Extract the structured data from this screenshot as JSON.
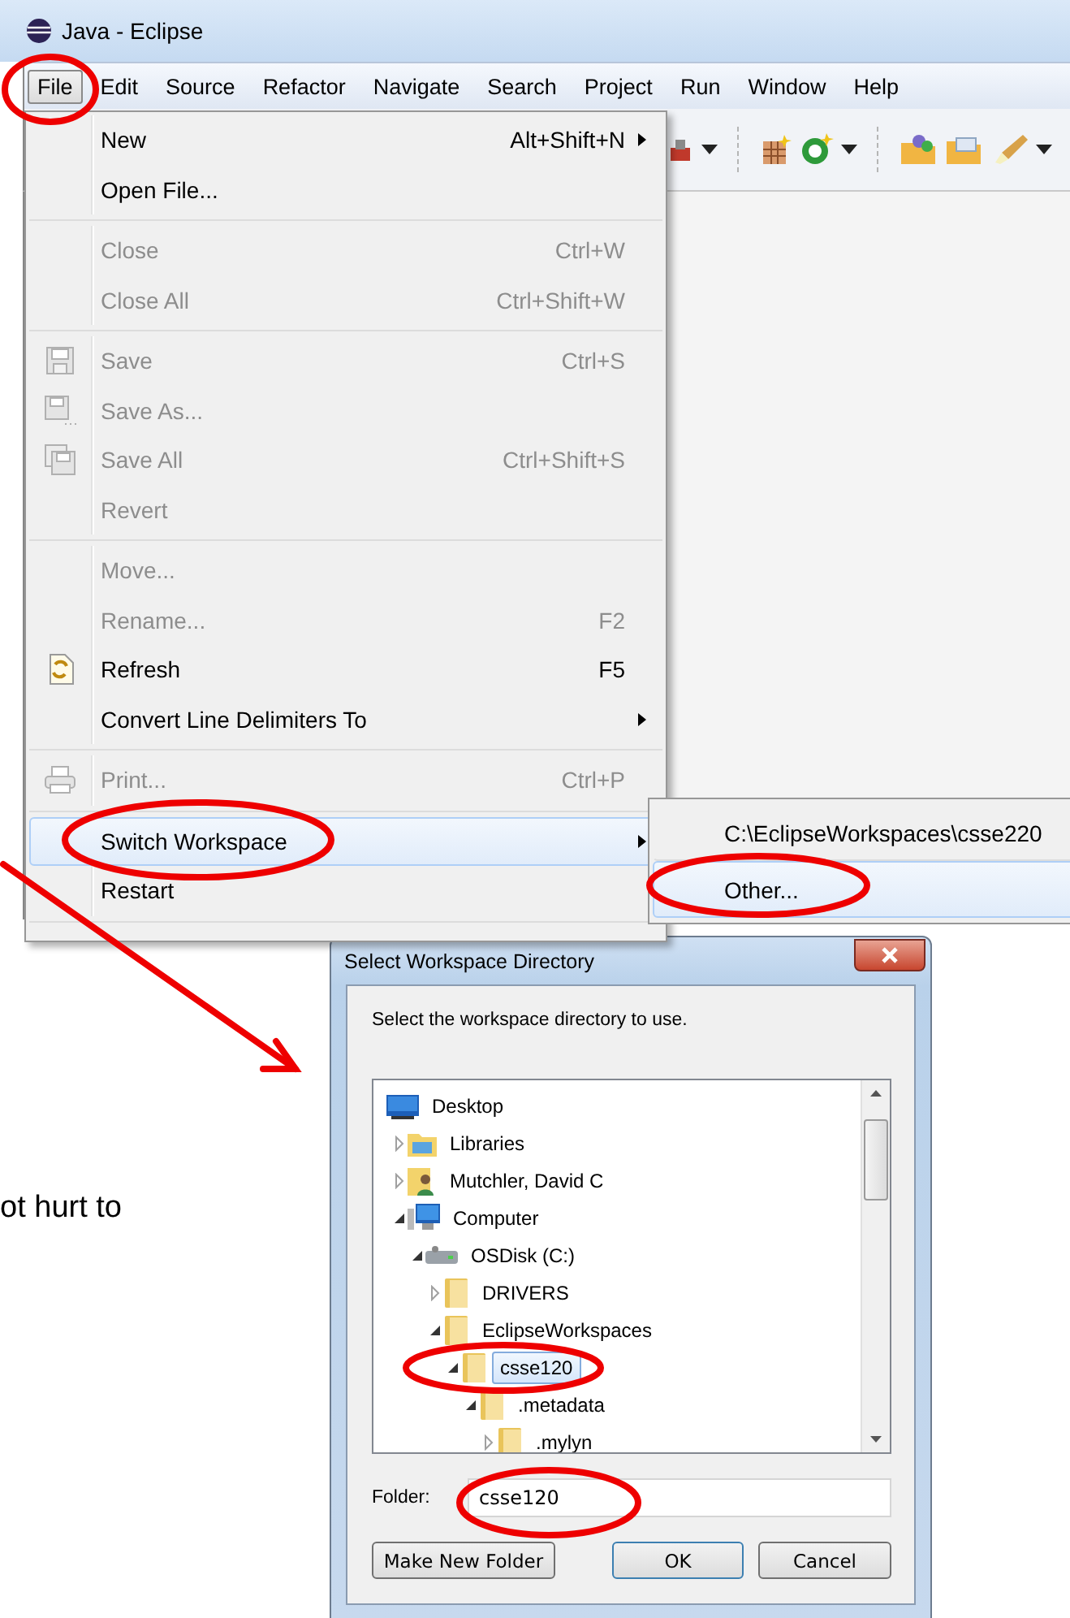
{
  "window": {
    "title": "Java - Eclipse"
  },
  "menubar": [
    {
      "label": "File",
      "selected": true
    },
    {
      "label": "Edit",
      "selected": false
    },
    {
      "label": "Source",
      "selected": false
    },
    {
      "label": "Refactor",
      "selected": false
    },
    {
      "label": "Navigate",
      "selected": false
    },
    {
      "label": "Search",
      "selected": false
    },
    {
      "label": "Project",
      "selected": false
    },
    {
      "label": "Run",
      "selected": false
    },
    {
      "label": "Window",
      "selected": false
    },
    {
      "label": "Help",
      "selected": false
    }
  ],
  "file_menu": {
    "groups": [
      {
        "items": [
          {
            "label": "New",
            "shortcut": "Alt+Shift+N",
            "kind": "plain",
            "disabled": false,
            "submenu": true,
            "selected": false
          },
          {
            "label": "Open File...",
            "kind": "plain",
            "disabled": false,
            "submenu": false,
            "selected": false
          }
        ]
      },
      {
        "items": [
          {
            "label": "Close",
            "shortcut": "Ctrl+W",
            "kind": "plain",
            "disabled": true,
            "submenu": false,
            "selected": false
          },
          {
            "label": "Close All",
            "shortcut": "Ctrl+Shift+W",
            "kind": "plain",
            "disabled": true,
            "submenu": false,
            "selected": false
          }
        ]
      },
      {
        "items": [
          {
            "label": "Save",
            "shortcut": "Ctrl+S",
            "kind": "save",
            "disabled": true,
            "submenu": false,
            "selected": false
          },
          {
            "label": "Save As...",
            "kind": "saveas",
            "disabled": true,
            "submenu": false,
            "selected": false
          },
          {
            "label": "Save All",
            "shortcut": "Ctrl+Shift+S",
            "kind": "saveall",
            "disabled": true,
            "submenu": false,
            "selected": false
          },
          {
            "label": "Revert",
            "kind": "plain",
            "disabled": true,
            "submenu": false,
            "selected": false
          }
        ]
      },
      {
        "items": [
          {
            "label": "Move...",
            "kind": "plain",
            "disabled": true,
            "submenu": false,
            "selected": false
          },
          {
            "label": "Rename...",
            "shortcut": "F2",
            "kind": "plain",
            "disabled": true,
            "submenu": false,
            "selected": false
          },
          {
            "label": "Refresh",
            "shortcut": "F5",
            "kind": "refresh",
            "disabled": false,
            "submenu": false,
            "selected": false
          },
          {
            "label": "Convert Line Delimiters To",
            "kind": "plain",
            "disabled": false,
            "submenu": true,
            "selected": false
          }
        ]
      },
      {
        "items": [
          {
            "label": "Print...",
            "shortcut": "Ctrl+P",
            "kind": "print",
            "disabled": true,
            "submenu": false,
            "selected": false
          }
        ]
      },
      {
        "items": [
          {
            "label": "Switch Workspace",
            "kind": "plain",
            "disabled": false,
            "submenu": true,
            "selected": true
          },
          {
            "label": "Restart",
            "kind": "plain",
            "disabled": false,
            "submenu": false,
            "selected": false
          }
        ]
      }
    ]
  },
  "workspace_submenu": [
    {
      "label": "C:\\EclipseWorkspaces\\csse220",
      "selected": false
    },
    {
      "label": "Other...",
      "selected": true
    }
  ],
  "side_text": "ot hurt to",
  "dialog": {
    "title": "Select Workspace Directory",
    "prompt": "Select the workspace directory to use.",
    "tree": [
      {
        "label": "Desktop",
        "kind": "desktop",
        "selected": false,
        "children": [
          {
            "label": "Libraries",
            "kind": "library",
            "expanded": false,
            "selected": false
          },
          {
            "label": "Mutchler, David C",
            "kind": "user",
            "expanded": false,
            "selected": false
          },
          {
            "label": "Computer",
            "kind": "computer",
            "expanded": true,
            "selected": false,
            "children": [
              {
                "label": "OSDisk (C:)",
                "kind": "drive",
                "expanded": true,
                "selected": false,
                "children": [
                  {
                    "label": "DRIVERS",
                    "kind": "folder",
                    "expanded": false,
                    "selected": false
                  },
                  {
                    "label": "EclipseWorkspaces",
                    "kind": "folder",
                    "expanded": true,
                    "selected": false,
                    "children": [
                      {
                        "label": "csse120",
                        "kind": "folder",
                        "expanded": true,
                        "selected": true,
                        "children": [
                          {
                            "label": ".metadata",
                            "kind": "folder",
                            "expanded": true,
                            "selected": false,
                            "children": [
                              {
                                "label": ".mylyn",
                                "kind": "folder",
                                "expanded": false,
                                "selected": false
                              }
                            ]
                          }
                        ]
                      }
                    ]
                  }
                ]
              }
            ]
          }
        ]
      }
    ],
    "folder_label": "Folder:",
    "folder_value": "csse120",
    "buttons": [
      {
        "label": "Make New Folder",
        "default": false
      },
      {
        "label": "OK",
        "default": true
      },
      {
        "label": "Cancel",
        "default": false
      }
    ]
  }
}
